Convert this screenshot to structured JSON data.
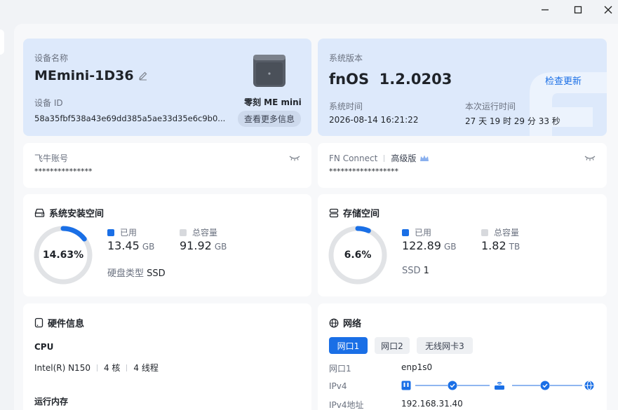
{
  "window": {
    "minimize": "minimize",
    "maximize": "maximize",
    "close": "close"
  },
  "device": {
    "name_label": "设备名称",
    "name": "MEmini-1D36",
    "id_label": "设备 ID",
    "id": "58a35fbf538a43e69dd385a5ae33d35e6c9b0...",
    "model": "零刻 ME mini",
    "more_info": "查看更多信息"
  },
  "system": {
    "version_label": "系统版本",
    "version": "fnOS  1.2.0203",
    "check_update": "检查更新",
    "time_label": "系统时间",
    "time": "2026-08-14 16:21:22",
    "uptime_label": "本次运行时间",
    "uptime": "27 天 19 时 29 分 33 秒"
  },
  "account": {
    "label": "飞牛账号",
    "value": "***************"
  },
  "fnconnect": {
    "label": "FN Connect",
    "tier": "高级版",
    "value": "******************"
  },
  "sys_space": {
    "title": "系统安装空间",
    "percent": "14.63%",
    "fraction": 0.1463,
    "used_label": "已用",
    "used_value": "13.45",
    "used_unit": "GB",
    "total_label": "总容量",
    "total_value": "91.92",
    "total_unit": "GB",
    "disk_type_label": "硬盘类型",
    "disk_type": "SSD"
  },
  "storage": {
    "title": "存储空间",
    "percent": "6.6%",
    "fraction": 0.066,
    "used_label": "已用",
    "used_value": "122.89",
    "used_unit": "GB",
    "total_label": "总容量",
    "total_value": "1.82",
    "total_unit": "TB",
    "ssd_label": "SSD",
    "ssd_count": "1"
  },
  "hardware": {
    "title": "硬件信息",
    "cpu_label": "CPU",
    "cpu_model": "Intel(R) N150",
    "cores": "4 核",
    "threads": "4 线程",
    "memory_label": "运行内存"
  },
  "network": {
    "title": "网络",
    "tabs": [
      "网口1",
      "网口2",
      "无线网卡3"
    ],
    "port_label": "网口1",
    "port_value": "enp1s0",
    "ipv4_label": "IPv4",
    "ipv4_addr_label": "IPv4地址",
    "ipv4_addr": "192.168.31.40"
  },
  "colors": {
    "accent": "#1a6fe6",
    "ring_bg": "#e1e3e6",
    "card_blue": "#dde9fb",
    "legend_gray": "#d7d9dd"
  }
}
